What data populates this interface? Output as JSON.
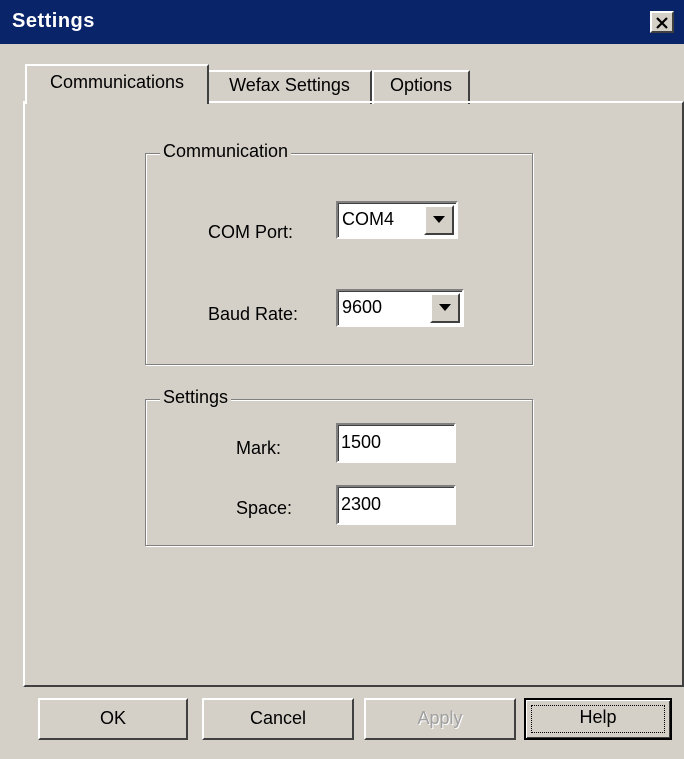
{
  "window": {
    "title": "Settings",
    "close_icon": "close-icon"
  },
  "tabs": [
    {
      "label": "Communications",
      "active": true
    },
    {
      "label": "Wefax Settings",
      "active": false
    },
    {
      "label": "Options",
      "active": false
    }
  ],
  "communication_group": {
    "label": "Communication",
    "com_port_label": "COM Port:",
    "com_port_value": "COM4",
    "baud_rate_label": "Baud Rate:",
    "baud_rate_value": "9600"
  },
  "settings_group": {
    "label": "Settings",
    "mark_label": "Mark:",
    "mark_value": "1500",
    "space_label": "Space:",
    "space_value": "2300"
  },
  "buttons": {
    "ok": "OK",
    "cancel": "Cancel",
    "apply": "Apply",
    "help": "Help"
  },
  "colors": {
    "titlebar": "#0a246a",
    "face": "#d4d0c8",
    "disabled_text": "#a0a0a0"
  }
}
